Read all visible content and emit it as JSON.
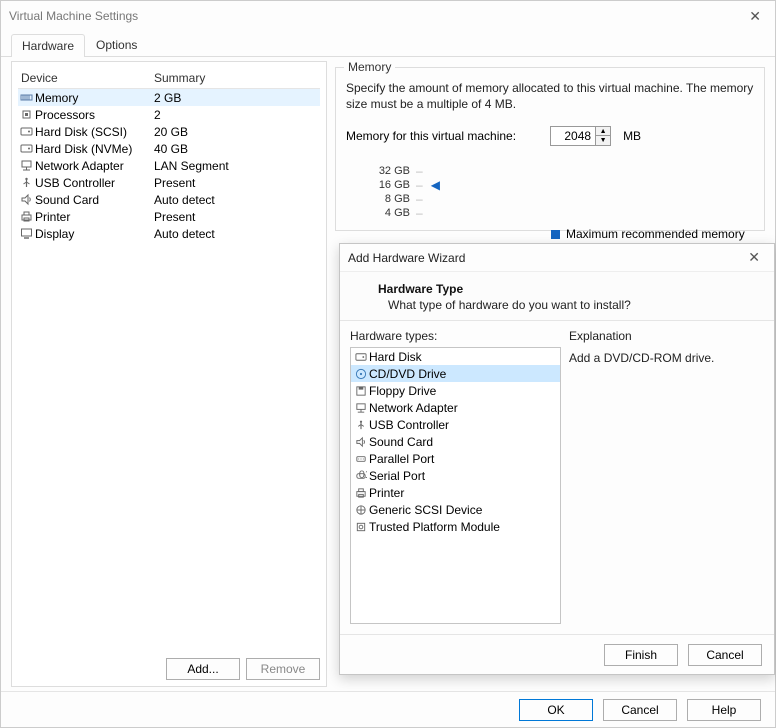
{
  "main": {
    "title": "Virtual Machine Settings",
    "tabs": {
      "hardware": "Hardware",
      "options": "Options"
    },
    "buttons": {
      "ok": "OK",
      "cancel": "Cancel",
      "help": "Help"
    }
  },
  "device_list": {
    "header_device": "Device",
    "header_summary": "Summary",
    "rows": [
      {
        "name": "Memory",
        "summary": "2 GB",
        "icon": "memory-icon",
        "selected": true
      },
      {
        "name": "Processors",
        "summary": "2",
        "icon": "cpu-icon"
      },
      {
        "name": "Hard Disk (SCSI)",
        "summary": "20 GB",
        "icon": "hdd-icon"
      },
      {
        "name": "Hard Disk (NVMe)",
        "summary": "40 GB",
        "icon": "hdd-icon"
      },
      {
        "name": "Network Adapter",
        "summary": "LAN Segment",
        "icon": "network-icon"
      },
      {
        "name": "USB Controller",
        "summary": "Present",
        "icon": "usb-icon"
      },
      {
        "name": "Sound Card",
        "summary": "Auto detect",
        "icon": "sound-icon"
      },
      {
        "name": "Printer",
        "summary": "Present",
        "icon": "printer-icon"
      },
      {
        "name": "Display",
        "summary": "Auto detect",
        "icon": "display-icon"
      }
    ],
    "add_button": "Add...",
    "remove_button": "Remove"
  },
  "memory_panel": {
    "group_label": "Memory",
    "description": "Specify the amount of memory allocated to this virtual machine. The memory size must be a multiple of 4 MB.",
    "input_label": "Memory for this virtual machine:",
    "value": "2048",
    "unit": "MB",
    "scale": [
      "32 GB",
      "16 GB",
      "8 GB",
      "4 GB"
    ],
    "legend_max": "Maximum recommended memory"
  },
  "wizard": {
    "title": "Add Hardware Wizard",
    "heading": "Hardware Type",
    "subheading": "What type of hardware do you want to install?",
    "hw_label": "Hardware types:",
    "expl_label": "Explanation",
    "explanation": "Add a DVD/CD-ROM drive.",
    "items": [
      {
        "name": "Hard Disk",
        "icon": "hdd-icon"
      },
      {
        "name": "CD/DVD Drive",
        "icon": "cd-icon",
        "selected": true
      },
      {
        "name": "Floppy Drive",
        "icon": "floppy-icon"
      },
      {
        "name": "Network Adapter",
        "icon": "network-icon"
      },
      {
        "name": "USB Controller",
        "icon": "usb-icon"
      },
      {
        "name": "Sound Card",
        "icon": "sound-icon"
      },
      {
        "name": "Parallel Port",
        "icon": "parallel-icon"
      },
      {
        "name": "Serial Port",
        "icon": "serial-icon"
      },
      {
        "name": "Printer",
        "icon": "printer-icon"
      },
      {
        "name": "Generic SCSI Device",
        "icon": "scsi-icon"
      },
      {
        "name": "Trusted Platform Module",
        "icon": "tpm-icon"
      }
    ],
    "buttons": {
      "finish": "Finish",
      "cancel": "Cancel"
    }
  }
}
